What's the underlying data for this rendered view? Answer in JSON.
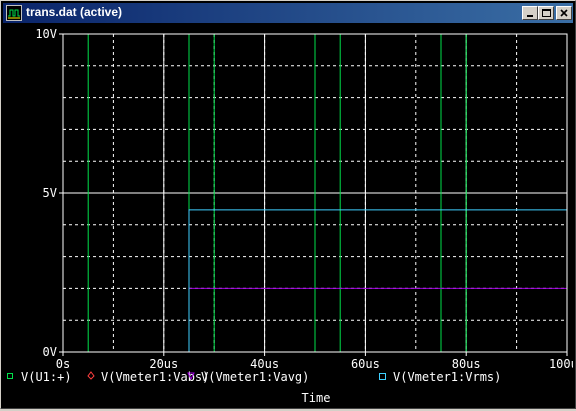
{
  "window": {
    "title": "trans.dat (active)",
    "icons": {
      "app": "probe-app-icon",
      "minimize": "minimize-icon",
      "maximize": "maximize-icon",
      "close": "close-icon"
    }
  },
  "colors": {
    "background": "#000000",
    "grid": "#ffffff",
    "axis_text": "#ffffff",
    "v_u1": "#00e04a",
    "vabs": "#ff3f3f",
    "vavg": "#a000e0",
    "vrms": "#3fd0ff"
  },
  "chart_data": {
    "type": "line",
    "xlabel": "Time",
    "ylabel": "",
    "xlim": [
      0,
      100
    ],
    "ylim": [
      0,
      10
    ],
    "x_unit": "us",
    "x_ticks": [
      0,
      20,
      40,
      60,
      80,
      100
    ],
    "x_tick_labels": [
      "0s",
      "20us",
      "40us",
      "60us",
      "80us",
      "100us"
    ],
    "y_ticks": [
      0,
      5,
      10
    ],
    "y_tick_labels": [
      "0V",
      "5V",
      "10V"
    ],
    "grid": true,
    "legend_position": "bottom",
    "series": [
      {
        "name": "V(U1:+)",
        "color": "#00e04a",
        "marker": "square",
        "x": [
          0,
          0,
          5,
          5,
          25,
          25,
          30,
          30,
          50,
          50,
          55,
          55,
          75,
          75,
          80,
          80,
          100
        ],
        "y": [
          0,
          10,
          10,
          0,
          0,
          10,
          10,
          0,
          0,
          10,
          10,
          0,
          0,
          10,
          10,
          0,
          0
        ]
      },
      {
        "name": "V(Vmeter1:Vabs)",
        "color": "#ff3f3f",
        "marker": "diamond",
        "x": [],
        "y": []
      },
      {
        "name": "V(Vmeter1:Vavg)",
        "color": "#a000e0",
        "marker": "triangle-down",
        "x": [
          25,
          100
        ],
        "y": [
          2.0,
          2.0
        ]
      },
      {
        "name": "V(Vmeter1:Vrms)",
        "color": "#3fd0ff",
        "marker": "square-open",
        "x": [
          0,
          25,
          25,
          100
        ],
        "y": [
          0,
          0,
          4.47,
          4.47
        ]
      }
    ]
  }
}
